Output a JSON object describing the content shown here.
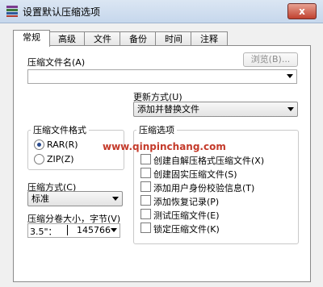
{
  "window": {
    "title": "设置默认压缩选项",
    "close_glyph": "x"
  },
  "tabs": [
    "常规",
    "高级",
    "文件",
    "备份",
    "时间",
    "注释"
  ],
  "archive_name": {
    "label": "压缩文件名(A)",
    "value": "",
    "browse_label": "浏览(B)..."
  },
  "update_mode": {
    "label": "更新方式(U)",
    "value": "添加并替换文件"
  },
  "archive_format": {
    "label": "压缩文件格式",
    "options": [
      "RAR(R)",
      "ZIP(Z)"
    ],
    "selected": "RAR(R)"
  },
  "compression_method": {
    "label": "压缩方式(C)",
    "value": "标准"
  },
  "split_volume": {
    "label": "压缩分卷大小，字节(V)",
    "value": "3.5\"：",
    "value_tail": "145766"
  },
  "options": {
    "label": "压缩选项",
    "items": [
      {
        "label": "创建自解压格式压缩文件(X)",
        "checked": false
      },
      {
        "label": "创建固实压缩文件(S)",
        "checked": false
      },
      {
        "label": "添加用户身份校验信息(T)",
        "checked": false
      },
      {
        "label": "添加恢复记录(P)",
        "checked": false
      },
      {
        "label": "测试压缩文件(E)",
        "checked": false
      },
      {
        "label": "锁定压缩文件(K)",
        "checked": false
      }
    ]
  },
  "watermark": "www.qinpinchang.com",
  "colors": {
    "title_bar": "#c6d7ec",
    "close_button": "#c0412f",
    "watermark": "#c43a2a"
  }
}
